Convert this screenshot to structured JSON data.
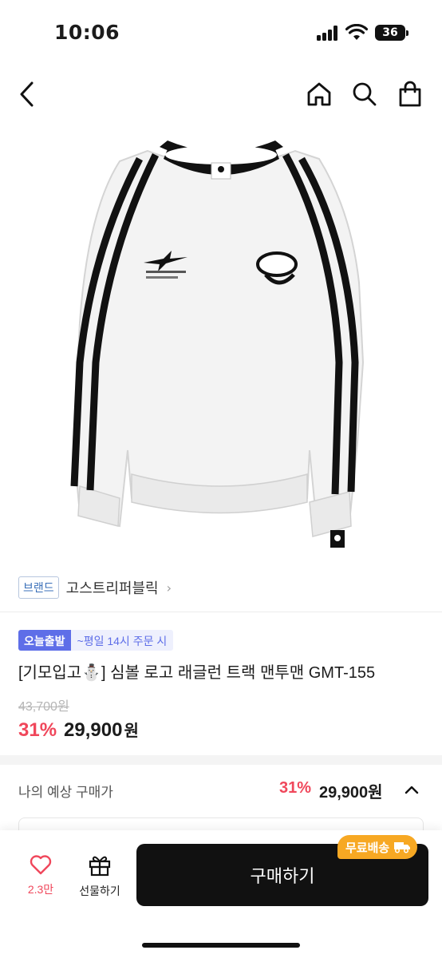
{
  "status_bar": {
    "time": "10:06",
    "battery": "36"
  },
  "nav": {
    "icons": [
      "back-icon",
      "home-icon",
      "search-icon",
      "shopping-bag-icon"
    ]
  },
  "brand": {
    "badge": "브랜드",
    "name": "고스트리퍼블릭",
    "chevron": "›"
  },
  "delivery": {
    "today_tag": "오늘출발",
    "cutoff": "~평일 14시 주문 시"
  },
  "product": {
    "title": "[기모입고⛄️] 심볼 로고 래글런 트랙 맨투맨 GMT-155",
    "original_price": "43,700원",
    "discount": "31%",
    "price": "29,900",
    "price_unit": "원"
  },
  "expected_price": {
    "label": "나의 예상 구매가",
    "discount": "31%",
    "price": "29,900원"
  },
  "bottom_bar": {
    "like_count": "2.3만",
    "gift_label": "선물하기",
    "buy_label": "구매하기",
    "free_shipping": "무료배송"
  },
  "colors": {
    "accent_red": "#f0475b",
    "brand_blue": "#5e6ee8",
    "shipping_orange": "#f7a823",
    "buy_button": "#111111"
  }
}
